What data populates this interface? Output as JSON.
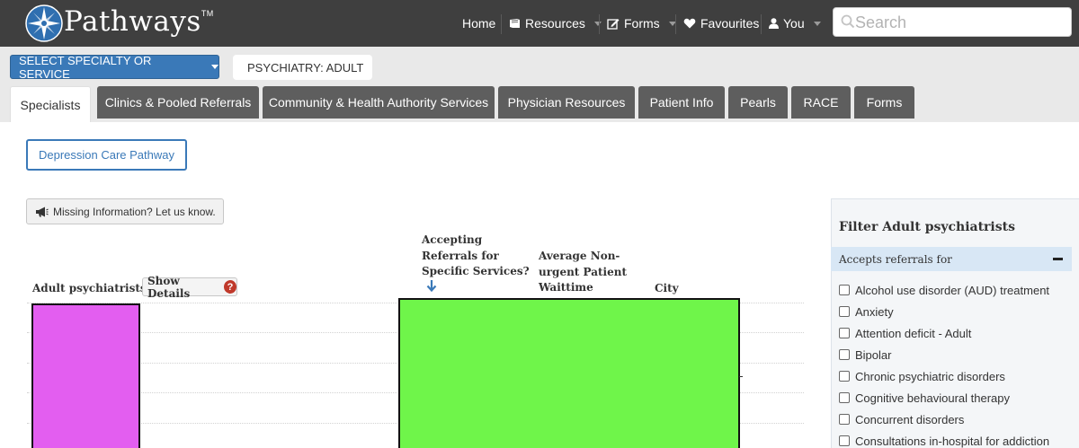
{
  "brand": {
    "name": "Pathways",
    "tm": "TM"
  },
  "nav": {
    "home": "Home",
    "resources": "Resources",
    "forms": "Forms",
    "favourites": "Favourites",
    "you": "You",
    "search_placeholder": "Search"
  },
  "subnav": {
    "select_label": "SELECT SPECIALTY OR SERVICE",
    "current": "PSYCHIATRY: ADULT"
  },
  "tabs": [
    {
      "label": "Specialists",
      "active": true
    },
    {
      "label": "Clinics & Pooled Referrals"
    },
    {
      "label": "Community & Health Authority Services"
    },
    {
      "label": "Physician Resources"
    },
    {
      "label": "Patient Info"
    },
    {
      "label": "Pearls"
    },
    {
      "label": "RACE"
    },
    {
      "label": "Forms"
    }
  ],
  "pathway_button": "Depression Care Pathway",
  "missing_info_button": "Missing Information? Let us know.",
  "table": {
    "col_name": "Adult psychiatrists",
    "show_details": "Show Details",
    "col_accepting": [
      "Accepting",
      "Referrals for",
      "Specific Services?"
    ],
    "col_wait": [
      "Average Non-",
      "urgent Patient",
      "Waittime"
    ],
    "col_city": "City"
  },
  "filter": {
    "title": "Filter Adult psychiatrists",
    "section": "Accepts referrals for",
    "options": [
      "Alcohol use disorder (AUD) treatment",
      "Anxiety",
      "Attention deficit - Adult",
      "Bipolar",
      "Chronic psychiatric disorders",
      "Cognitive behavioural therapy",
      "Concurrent disorders",
      "Consultations in-hospital for addiction"
    ]
  },
  "colors": {
    "nav_bg": "#3f3f3f",
    "accent_blue": "#3a79b8",
    "tab_bg": "#5e5e5e",
    "redaction_pink": "#e35ef0",
    "redaction_green": "#6ff54a"
  }
}
